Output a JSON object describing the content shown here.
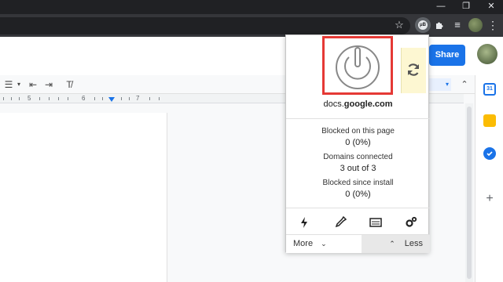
{
  "window": {
    "minimize_glyph": "—",
    "restore_glyph": "❐",
    "close_glyph": "✕"
  },
  "toolbar_icons": {
    "star": "☆",
    "ublock_badge": "μB",
    "puzzle": "✦",
    "media": "≡",
    "menu": "⋮"
  },
  "docs": {
    "share_label": "Share"
  },
  "format_toolbar": {
    "bullets": "☰",
    "bullets_caret": "▾",
    "outdent": "⇤",
    "indent": "⇥",
    "clear_format": "T̸",
    "dropdown_caret": "▾",
    "collapse": "⌃"
  },
  "ruler": {
    "labels": [
      "5",
      "6",
      "7"
    ]
  },
  "popup": {
    "hostname_prefix": "docs.",
    "hostname_main": "google.com",
    "stats": [
      {
        "label": "Blocked on this page",
        "value": "0 (0%)"
      },
      {
        "label": "Domains connected",
        "value": "3 out of 3"
      },
      {
        "label": "Blocked since install",
        "value": "0 (0%)"
      }
    ],
    "more_label": "More",
    "less_label": "Less",
    "more_chevron": "⌄",
    "less_chevron": "⌃"
  },
  "side_panel": {
    "calendar_text": "31",
    "plus": "+"
  },
  "colors": {
    "accent": "#1a73e8",
    "highlight_border": "#e53935",
    "refresh_bg": "#fdf7d2"
  }
}
